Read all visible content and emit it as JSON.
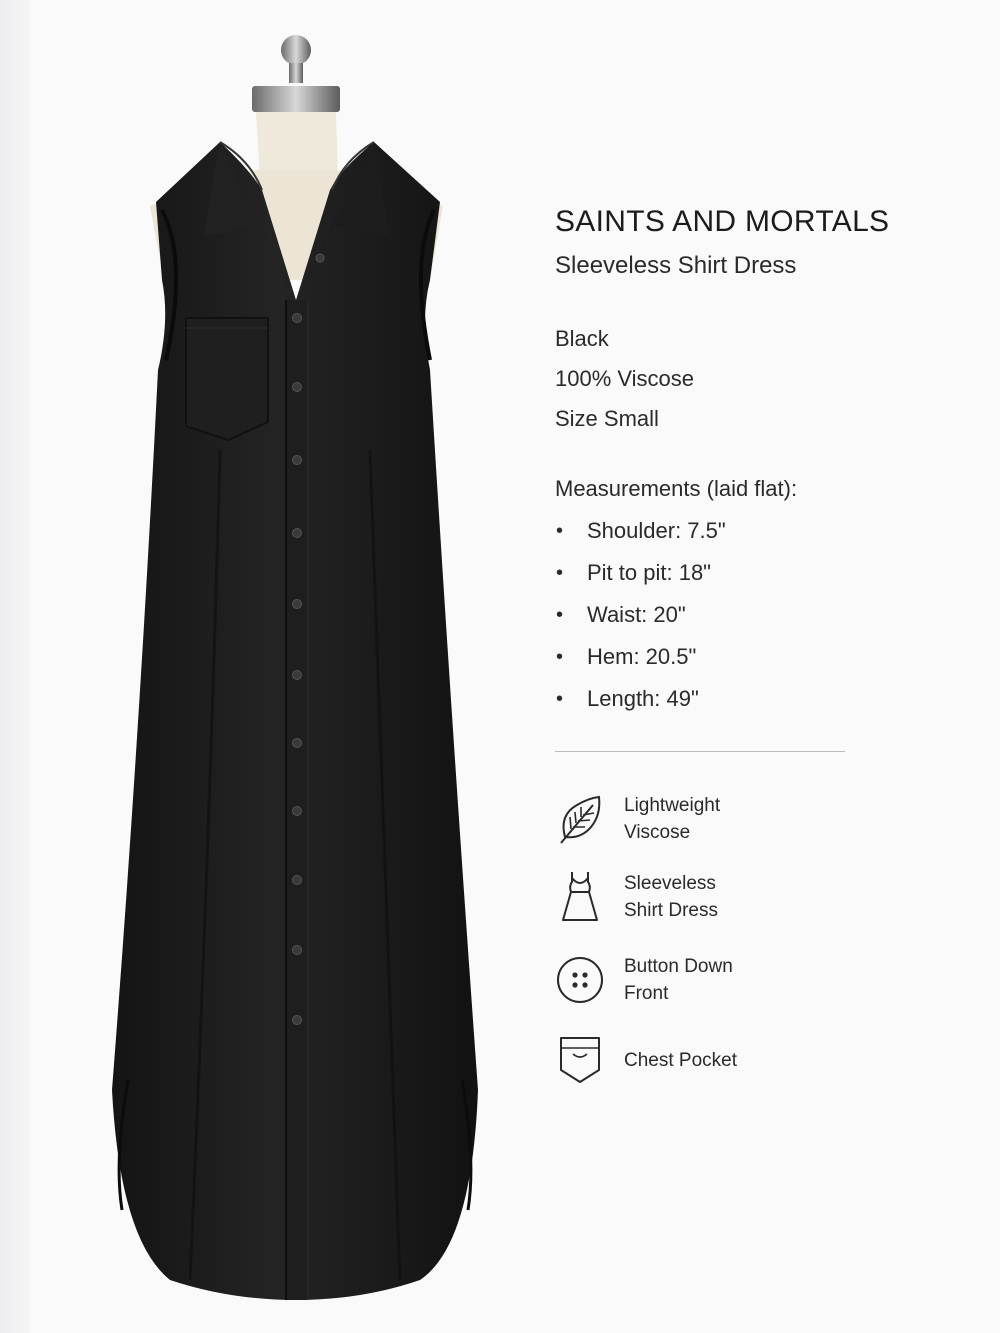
{
  "product": {
    "brand": "SAINTS AND MORTALS",
    "name": "Sleeveless Shirt Dress",
    "color": "Black",
    "material": "100% Viscose",
    "size": "Size Small"
  },
  "measurements": {
    "heading": "Measurements (laid flat):",
    "items": [
      "Shoulder: 7.5\"",
      "Pit to pit: 18\"",
      "Waist: 20\"",
      "Hem: 20.5\"",
      "Length: 49\""
    ]
  },
  "features": [
    {
      "icon": "leaf-icon",
      "line1": "Lightweight",
      "line2": "Viscose"
    },
    {
      "icon": "dress-icon",
      "line1": "Sleeveless",
      "line2": "Shirt Dress"
    },
    {
      "icon": "button-icon",
      "line1": "Button Down",
      "line2": "Front"
    },
    {
      "icon": "pocket-icon",
      "line1": "Chest Pocket",
      "line2": ""
    }
  ],
  "colors": {
    "dress": "#1b1b1b",
    "background": "#fafafa",
    "text": "#2a2a2a"
  }
}
